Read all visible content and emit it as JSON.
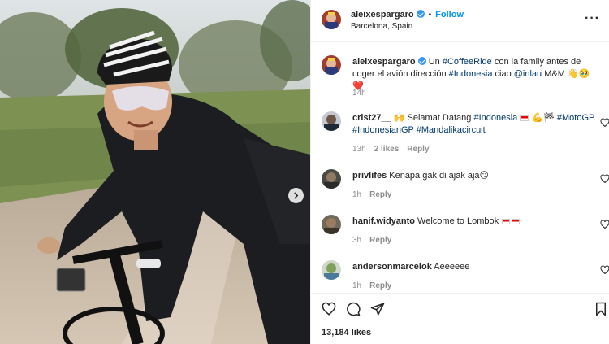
{
  "post": {
    "username": "aleixespargaro",
    "follow_label": "Follow",
    "location": "Barcelona, Spain",
    "caption_parts": [
      "Un ",
      "#CoffeeRide",
      " con la family antes de coger el avión dirección ",
      "#Indonesia",
      " ciao ",
      "@inlau",
      " M&M 👋🥹❤️"
    ],
    "caption_time": "14h",
    "likes": "13,184 likes"
  },
  "comments": [
    {
      "username": "crist27__",
      "text_a": " 🙌 Selamat Datang ",
      "tag1": "#Indonesia",
      "text_b": " 💪🏁 ",
      "tag2": "#MotoGP",
      "tag3": "#IndonesianGP",
      "tag4": "#Mandalikacircuit",
      "time": "13h",
      "likes": "2 likes",
      "reply": "Reply"
    },
    {
      "username": "privlifes",
      "text": " Kenapa gak di ajak aja😏",
      "time": "1h",
      "reply": "Reply"
    },
    {
      "username": "hanif.widyanto",
      "text": " Welcome to Lombok ",
      "time": "3h",
      "reply": "Reply"
    },
    {
      "username": "andersonmarcelok",
      "text": " Aeeeeee",
      "time": "1h",
      "reply": "Reply"
    }
  ],
  "icons": {
    "more": "more-options-icon",
    "like": "heart-icon",
    "comment": "comment-icon",
    "share": "share-icon",
    "save": "bookmark-icon",
    "next": "chevron-right-icon"
  },
  "colors": {
    "accent": "#0095f6",
    "hashtag": "#00376b",
    "muted": "#8e8e8e",
    "verified": "#3897f0"
  }
}
